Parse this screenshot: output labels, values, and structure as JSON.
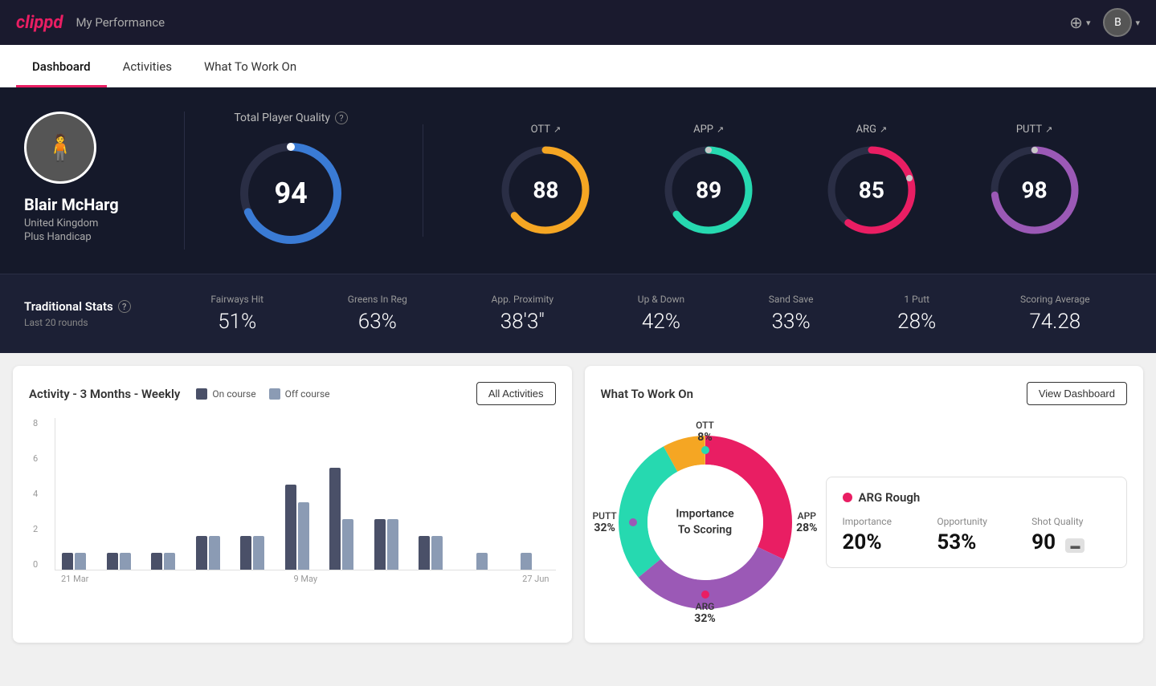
{
  "header": {
    "logo": "clippd",
    "title": "My Performance",
    "add_icon": "⊕",
    "avatar_initial": "B"
  },
  "nav": {
    "tabs": [
      {
        "label": "Dashboard",
        "active": true
      },
      {
        "label": "Activities",
        "active": false
      },
      {
        "label": "What To Work On",
        "active": false
      }
    ]
  },
  "player": {
    "name": "Blair McHarg",
    "country": "United Kingdom",
    "handicap": "Plus Handicap"
  },
  "total_quality": {
    "label": "Total Player Quality",
    "value": "94",
    "color": "#3a7bd5"
  },
  "scores": [
    {
      "label": "OTT",
      "value": "88",
      "color": "#f5a623",
      "arrow": "↗"
    },
    {
      "label": "APP",
      "value": "89",
      "color": "#26d9b0",
      "arrow": "↗"
    },
    {
      "label": "ARG",
      "value": "85",
      "color": "#e91e63",
      "arrow": "↗"
    },
    {
      "label": "PUTT",
      "value": "98",
      "color": "#9b59b6",
      "arrow": "↗"
    }
  ],
  "traditional_stats": {
    "title": "Traditional Stats",
    "subtitle": "Last 20 rounds",
    "items": [
      {
        "name": "Fairways Hit",
        "value": "51%"
      },
      {
        "name": "Greens In Reg",
        "value": "63%"
      },
      {
        "name": "App. Proximity",
        "value": "38'3\""
      },
      {
        "name": "Up & Down",
        "value": "42%"
      },
      {
        "name": "Sand Save",
        "value": "33%"
      },
      {
        "name": "1 Putt",
        "value": "28%"
      },
      {
        "name": "Scoring Average",
        "value": "74.28"
      }
    ]
  },
  "activity_chart": {
    "title": "Activity - 3 Months - Weekly",
    "legend": [
      {
        "label": "On course",
        "color": "#4a5068"
      },
      {
        "label": "Off course",
        "color": "#8b9bb4"
      }
    ],
    "all_activities_label": "All Activities",
    "y_labels": [
      "0",
      "2",
      "4",
      "6",
      "8"
    ],
    "x_labels": [
      "21 Mar",
      "9 May",
      "27 Jun"
    ],
    "bars": [
      {
        "on": 1,
        "off": 1
      },
      {
        "on": 1,
        "off": 1
      },
      {
        "on": 1,
        "off": 1
      },
      {
        "on": 2,
        "off": 2
      },
      {
        "on": 2,
        "off": 2
      },
      {
        "on": 5,
        "off": 4
      },
      {
        "on": 6,
        "off": 3
      },
      {
        "on": 3,
        "off": 3
      },
      {
        "on": 2,
        "off": 2
      },
      {
        "on": 0,
        "off": 1
      },
      {
        "on": 0,
        "off": 1
      }
    ]
  },
  "what_to_work_on": {
    "title": "What To Work On",
    "view_dashboard_label": "View Dashboard",
    "donut_center": "Importance\nTo Scoring",
    "segments": [
      {
        "label": "OTT",
        "pct": "8%",
        "color": "#f5a623"
      },
      {
        "label": "APP",
        "pct": "28%",
        "color": "#26d9b0"
      },
      {
        "label": "ARG",
        "pct": "32%",
        "color": "#e91e63"
      },
      {
        "label": "PUTT",
        "pct": "32%",
        "color": "#9b59b6"
      }
    ],
    "detail": {
      "title": "ARG Rough",
      "importance_label": "Importance",
      "importance_value": "20%",
      "opportunity_label": "Opportunity",
      "opportunity_value": "53%",
      "shot_quality_label": "Shot Quality",
      "shot_quality_value": "90"
    }
  }
}
